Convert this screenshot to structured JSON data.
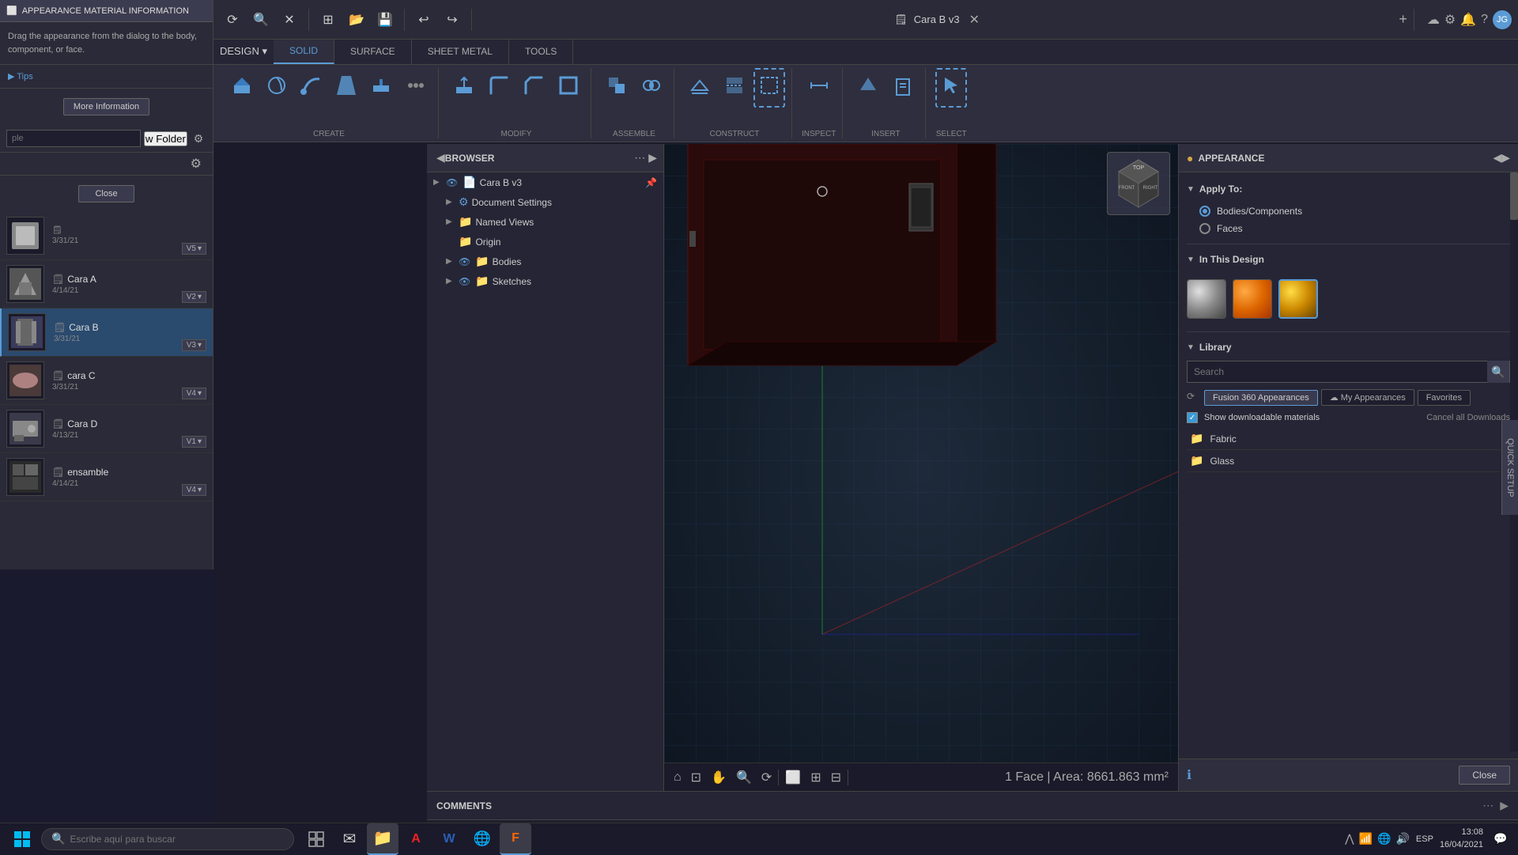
{
  "app": {
    "title": "APPEARANCE MATERIAL INFORMATION",
    "tab_title": "Cara B v3"
  },
  "window_controls": {
    "minimize": "−",
    "maximize": "□",
    "close": "✕"
  },
  "left_panel": {
    "title": "APPEARANCE MATERIAL INFORMATION",
    "info_text": "Drag the appearance from the dialog to the body, component, or face.",
    "tips_label": "▶ Tips",
    "more_info_btn": "More Information",
    "search_placeholder": "ple",
    "folder_btn": "w Folder",
    "close_btn": "Close"
  },
  "files": [
    {
      "name": "",
      "date": "3/31/21",
      "version": "V5",
      "has_thumb": true
    },
    {
      "name": "Cara A",
      "date": "4/14/21",
      "version": "V2",
      "has_thumb": true
    },
    {
      "name": "Cara B",
      "date": "3/31/21",
      "version": "V3",
      "has_thumb": true,
      "selected": true
    },
    {
      "name": "cara C",
      "date": "3/31/21",
      "version": "V4",
      "has_thumb": true
    },
    {
      "name": "Cara D",
      "date": "4/13/21",
      "version": "V1",
      "has_thumb": true
    },
    {
      "name": "ensamble",
      "date": "4/14/21",
      "version": "V4",
      "has_thumb": true
    }
  ],
  "toolbar": {
    "reload_icon": "⟳",
    "search_icon": "🔍",
    "close_icon": "✕",
    "grid_icon": "⊞",
    "save_icon": "💾",
    "undo_icon": "↩",
    "redo_icon": "↪",
    "new_tab_icon": "+",
    "cloud_icon": "☁",
    "bell_icon": "🔔",
    "help_icon": "?",
    "user_icon": "JG"
  },
  "tabs": [
    {
      "label": "SOLID",
      "active": true
    },
    {
      "label": "SURFACE",
      "active": false
    },
    {
      "label": "SHEET METAL",
      "active": false
    },
    {
      "label": "TOOLS",
      "active": false
    }
  ],
  "tool_groups": [
    {
      "label": "CREATE",
      "icon": "📐"
    },
    {
      "label": "MODIFY",
      "icon": "✏"
    },
    {
      "label": "ASSEMBLE",
      "icon": "🔩"
    },
    {
      "label": "CONSTRUCT",
      "icon": "📏"
    },
    {
      "label": "INSPECT",
      "icon": "🔬"
    },
    {
      "label": "INSERT",
      "icon": "📥"
    },
    {
      "label": "SELECT",
      "icon": "↖"
    }
  ],
  "browser": {
    "title": "BROWSER",
    "items": [
      {
        "label": "Cara B v3",
        "indent": 0,
        "has_eye": true,
        "has_pin": true
      },
      {
        "label": "Document Settings",
        "indent": 1,
        "has_expand": true
      },
      {
        "label": "Named Views",
        "indent": 1,
        "has_expand": true
      },
      {
        "label": "Origin",
        "indent": 1
      },
      {
        "label": "Bodies",
        "indent": 1,
        "has_eye": true,
        "has_expand": true
      },
      {
        "label": "Sketches",
        "indent": 1,
        "has_eye": true,
        "has_expand": true
      }
    ]
  },
  "appearance_panel": {
    "title": "APPEARANCE",
    "apply_to_label": "Apply To:",
    "bodies_components_label": "Bodies/Components",
    "faces_label": "Faces",
    "in_this_design_label": "In This Design",
    "library_label": "Library",
    "search_placeholder": "Search",
    "tabs": [
      {
        "label": "Fusion 360 Appearances",
        "active": true
      },
      {
        "label": "My Appearances",
        "active": false
      },
      {
        "label": "Favorites",
        "active": false
      }
    ],
    "show_downloadable_label": "Show downloadable materials",
    "cancel_downloads_label": "Cancel all Downloads",
    "folders": [
      {
        "label": "Fabric"
      },
      {
        "label": "Glass"
      }
    ],
    "close_btn": "Close",
    "info_icon": "ℹ"
  },
  "quick_setup": {
    "label": "QUICK SETUP"
  },
  "comments": {
    "label": "COMMENTS"
  },
  "status_bar": {
    "text": "1 Face | Area: 8661.863 mm²"
  },
  "media_controls": {
    "first": "⏮",
    "prev": "◀",
    "play": "▶",
    "next": "▶",
    "last": "⏭"
  },
  "taskbar": {
    "search_placeholder": "Escribe aquí para buscar",
    "time": "13:08",
    "date": "16/04/2021",
    "lang": "ESP",
    "apps": [
      "⊞",
      "🔍",
      "📋",
      "✉",
      "📁",
      "A",
      "W",
      "🌐",
      "F"
    ]
  },
  "design_btn_label": "DESIGN ▾"
}
